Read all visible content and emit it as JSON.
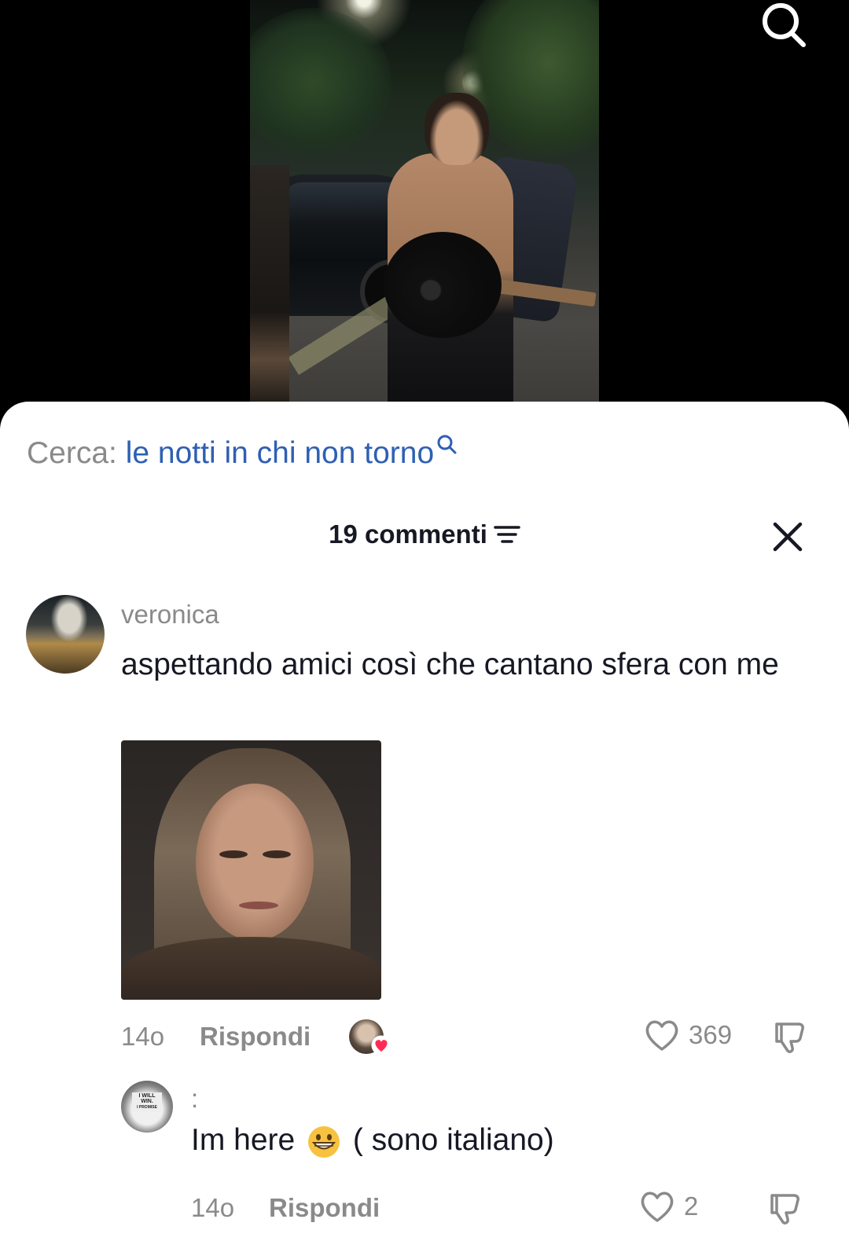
{
  "top_bar": {
    "search_icon": "search-icon"
  },
  "search_suggestion": {
    "label": "Cerca:",
    "query": "le notti in chi non torno",
    "link_color": "#2f5fb3"
  },
  "comments_header": {
    "count_label": "19 commenti",
    "filter_icon": "filter-icon",
    "close_icon": "close-icon"
  },
  "comments": [
    {
      "username": "veronica",
      "text": "aspettando amici così che cantano sfera con me",
      "time": "14o",
      "reply_label": "Rispondi",
      "likes": "369",
      "creator_liked": true
    },
    {
      "username": ":",
      "text": "Im here",
      "emoji": "grinning-face",
      "text_after": "( sono italiano)",
      "time": "14o",
      "reply_label": "Rispondi",
      "likes": "2"
    }
  ],
  "colors": {
    "heart_red": "#fe2c55",
    "text_dark": "#161823",
    "text_gray": "#8a8a8a"
  }
}
